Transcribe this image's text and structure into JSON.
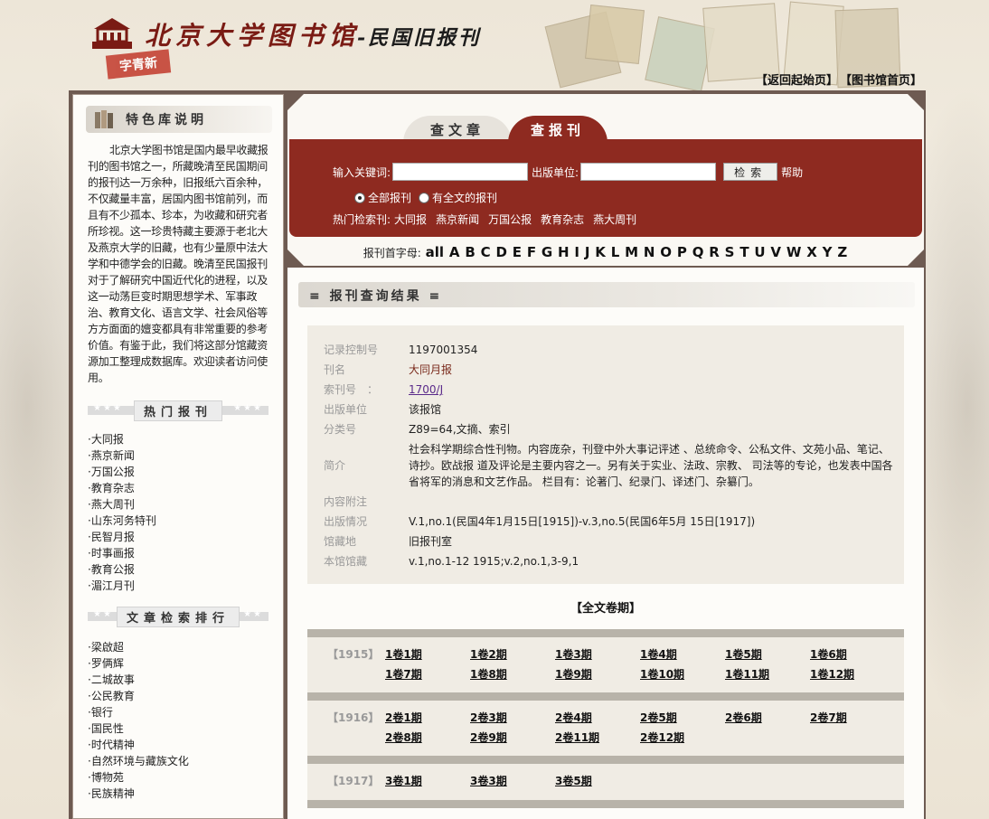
{
  "header": {
    "logo_text": "北京大学图书馆",
    "logo_sub": "-民国旧报刊",
    "stamp": "字青新",
    "links": [
      "【返回起始页】",
      "【图书馆首页】"
    ]
  },
  "sidebar": {
    "title": "特色库说明",
    "description": "北京大学图书馆是国内最早收藏报刊的图书馆之一，所藏晚清至民国期间的报刊达一万余种，旧报纸六百余种，不仅藏量丰富，居国内图书馆前列，而且有不少孤本、珍本，为收藏和研究者所珍视。这一珍贵特藏主要源于老北大及燕京大学的旧藏，也有少量原中法大学和中德学会的旧藏。晚清至民国报刊对于了解研究中国近代化的进程，以及这一动荡巨变时期思想学术、军事政治、教育文化、语言文学、社会风俗等方方面面的嬗变都具有非常重要的参考价值。有鉴于此，我们将这部分馆藏资源加工整理成数据库。欢迎读者访问使用。",
    "hot_title": "热门报刊",
    "hot_items": [
      "大同报",
      "燕京新闻",
      "万国公报",
      "教育杂志",
      "燕大周刊",
      "山东河务特刊",
      "民智月报",
      "时事画报",
      "教育公报",
      "湄江月刊"
    ],
    "rank_title": "文章检索排行",
    "rank_items": [
      "梁啟超",
      "罗俩辉",
      "二城故事",
      "公民教育",
      "银行",
      "国民性",
      "时代精神",
      "自然环境与藏族文化",
      "博物苑",
      "民族精神"
    ]
  },
  "search": {
    "tab_article": "查文章",
    "tab_journal": "查报刊",
    "keyword_label": "输入关键词:",
    "publisher_label": "出版单位:",
    "search_btn": "检索",
    "help": "帮助",
    "radio_all": "全部报刊",
    "radio_full": "有全文的报刊",
    "hot_label": "热门检索刊:",
    "hot_links": [
      "大同报",
      "燕京新闻",
      "万国公报",
      "教育杂志",
      "燕大周刊"
    ],
    "letters_label": "报刊首字母:",
    "letters": [
      "all",
      "A",
      "B",
      "C",
      "D",
      "E",
      "F",
      "G",
      "H",
      "I",
      "J",
      "K",
      "L",
      "M",
      "N",
      "O",
      "P",
      "Q",
      "R",
      "S",
      "T",
      "U",
      "V",
      "W",
      "X",
      "Y",
      "Z"
    ]
  },
  "result": {
    "title": "≡ 报刊查询结果 ≡",
    "fields": [
      {
        "k": "记录控制号",
        "v": "1197001354",
        "style": ""
      },
      {
        "k": "刊名",
        "v": "大同月报",
        "style": "red"
      },
      {
        "k": "索刊号　：",
        "v": "1700/J",
        "style": "link"
      },
      {
        "k": "出版单位",
        "v": "该报馆",
        "style": ""
      },
      {
        "k": "分类号",
        "v": "Z89=64,文摘、索引",
        "style": ""
      },
      {
        "k": "简介",
        "v": "社会科学期综合性刊物。内容庞杂，刊登中外大事记评述 、总统命令、公私文件、文苑小品、笔记、诗抄。欧战报 道及评论是主要内容之一。另有关于实业、法政、宗教、 司法等的专论，也发表中国各省将军的消息和文艺作品。 栏目有：论著门、纪录门、译述门、杂纂门。",
        "style": ""
      },
      {
        "k": "内容附注",
        "v": "",
        "style": ""
      },
      {
        "k": "出版情况",
        "v": "V.1,no.1(民国4年1月15日[1915])-v.3,no.5(民国6年5月 15日[1917])",
        "style": ""
      },
      {
        "k": "馆藏地",
        "v": "旧报刊室",
        "style": ""
      },
      {
        "k": "本馆馆藏",
        "v": "v.1,no.1-12 1915;v.2,no.1,3-9,1",
        "style": ""
      }
    ],
    "fulltext_title": "【全文卷期】",
    "years": [
      {
        "year": "【1915】",
        "issues": [
          "1卷1期",
          "1卷2期",
          "1卷3期",
          "1卷4期",
          "1卷5期",
          "1卷6期",
          "1卷7期",
          "1卷8期",
          "1卷9期",
          "1卷10期",
          "1卷11期",
          "1卷12期"
        ]
      },
      {
        "year": "【1916】",
        "issues": [
          "2卷1期",
          "2卷3期",
          "2卷4期",
          "2卷5期",
          "2卷6期",
          "2卷7期",
          "2卷8期",
          "2卷9期",
          "2卷11期",
          "2卷12期"
        ]
      },
      {
        "year": "【1917】",
        "issues": [
          "3卷1期",
          "3卷3期",
          "3卷5期"
        ]
      }
    ]
  }
}
